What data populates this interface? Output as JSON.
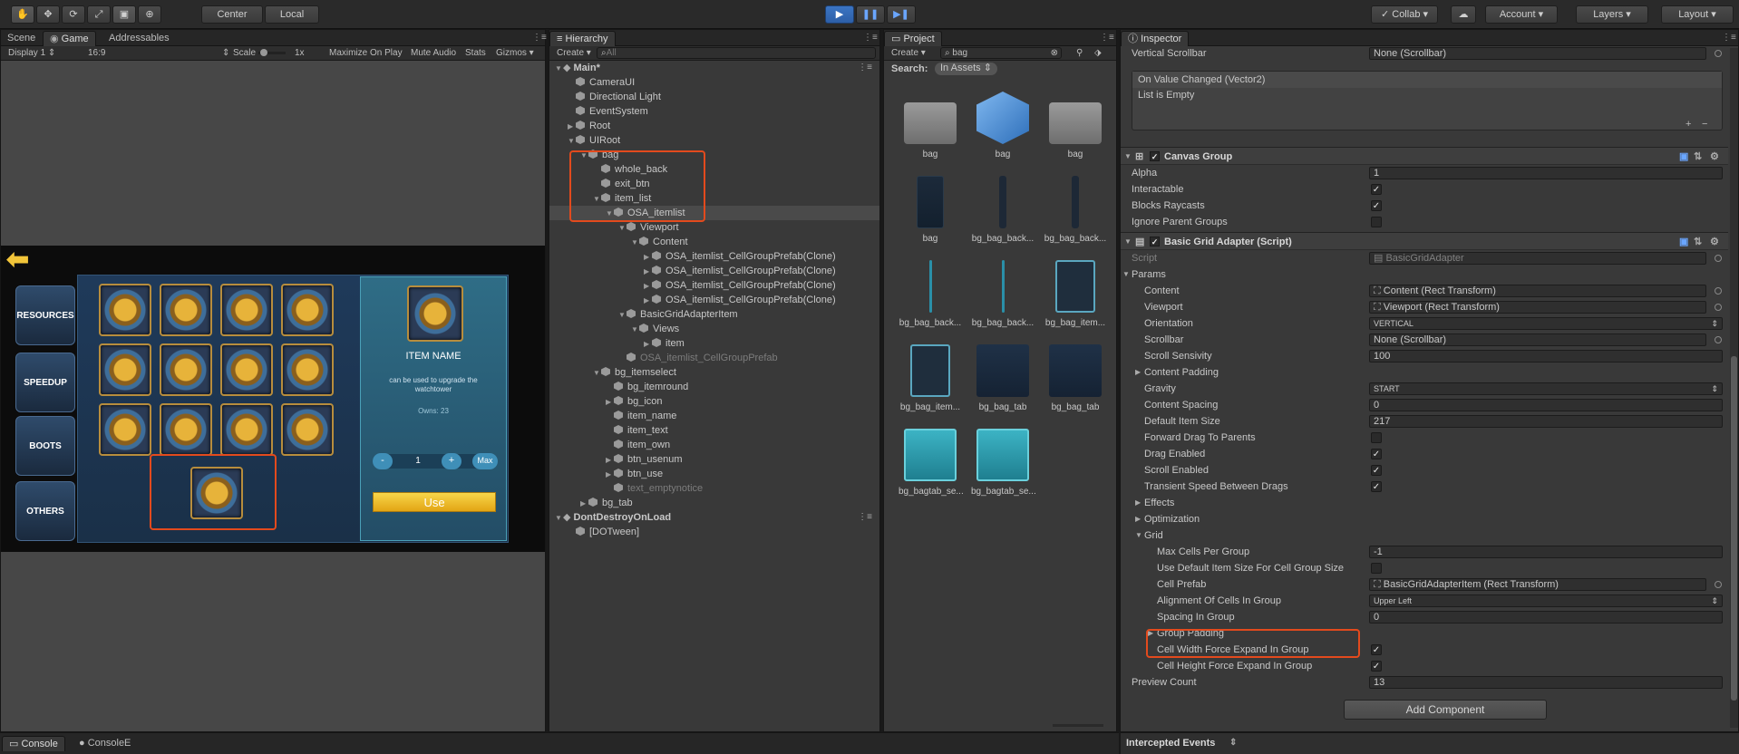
{
  "toolbar": {
    "pivot_center": "Center",
    "pivot_local": "Local",
    "collab": "Collab",
    "account": "Account",
    "layers": "Layers",
    "layout": "Layout"
  },
  "game_panel": {
    "tabs": [
      "Scene",
      "Game",
      "Addressables"
    ],
    "display": "Display 1",
    "aspect": "16:9",
    "scale_label": "Scale",
    "scale_value": "1x",
    "maximize": "Maximize On Play",
    "mute": "Mute Audio",
    "stats": "Stats",
    "gizmos": "Gizmos",
    "side_buttons": [
      "RESOURCES",
      "SPEEDUP",
      "BOOTS",
      "OTHERS"
    ],
    "detail": {
      "item_name": "ITEM NAME",
      "description": "can be used to upgrade the watchtower",
      "owns": "Owns: 23",
      "minus": "-",
      "quantity": "1",
      "plus": "+",
      "max": "Max",
      "use": "Use"
    }
  },
  "hierarchy": {
    "title": "Hierarchy",
    "create": "Create",
    "search_placeholder": "All",
    "rows": [
      {
        "label": "Main*",
        "indent": 0,
        "arrow": "▼",
        "scene": true
      },
      {
        "label": "CameraUI",
        "indent": 1,
        "arrow": ""
      },
      {
        "label": "Directional Light",
        "indent": 1,
        "arrow": ""
      },
      {
        "label": "EventSystem",
        "indent": 1,
        "arrow": ""
      },
      {
        "label": "Root",
        "indent": 1,
        "arrow": "▶"
      },
      {
        "label": "UIRoot",
        "indent": 1,
        "arrow": "▼"
      },
      {
        "label": "bag",
        "indent": 2,
        "arrow": "▼"
      },
      {
        "label": "whole_back",
        "indent": 3,
        "arrow": ""
      },
      {
        "label": "exit_btn",
        "indent": 3,
        "arrow": ""
      },
      {
        "label": "item_list",
        "indent": 3,
        "arrow": "▼"
      },
      {
        "label": "OSA_itemlist",
        "indent": 4,
        "arrow": "▼",
        "selected": true
      },
      {
        "label": "Viewport",
        "indent": 5,
        "arrow": "▼"
      },
      {
        "label": "Content",
        "indent": 6,
        "arrow": "▼"
      },
      {
        "label": "OSA_itemlist_CellGroupPrefab(Clone)",
        "indent": 7,
        "arrow": "▶"
      },
      {
        "label": "OSA_itemlist_CellGroupPrefab(Clone)",
        "indent": 7,
        "arrow": "▶"
      },
      {
        "label": "OSA_itemlist_CellGroupPrefab(Clone)",
        "indent": 7,
        "arrow": "▶"
      },
      {
        "label": "OSA_itemlist_CellGroupPrefab(Clone)",
        "indent": 7,
        "arrow": "▶"
      },
      {
        "label": "BasicGridAdapterItem",
        "indent": 5,
        "arrow": "▼"
      },
      {
        "label": "Views",
        "indent": 6,
        "arrow": "▼"
      },
      {
        "label": "item",
        "indent": 7,
        "arrow": "▶"
      },
      {
        "label": "OSA_itemlist_CellGroupPrefab",
        "indent": 5,
        "arrow": "",
        "dim": true
      },
      {
        "label": "bg_itemselect",
        "indent": 3,
        "arrow": "▼"
      },
      {
        "label": "bg_itemround",
        "indent": 4,
        "arrow": ""
      },
      {
        "label": "bg_icon",
        "indent": 4,
        "arrow": "▶"
      },
      {
        "label": "item_name",
        "indent": 4,
        "arrow": ""
      },
      {
        "label": "item_text",
        "indent": 4,
        "arrow": ""
      },
      {
        "label": "item_own",
        "indent": 4,
        "arrow": ""
      },
      {
        "label": "btn_usenum",
        "indent": 4,
        "arrow": "▶"
      },
      {
        "label": "btn_use",
        "indent": 4,
        "arrow": "▶"
      },
      {
        "label": "text_emptynotice",
        "indent": 4,
        "arrow": "",
        "dim": true
      },
      {
        "label": "bg_tab",
        "indent": 2,
        "arrow": "▶"
      },
      {
        "label": "DontDestroyOnLoad",
        "indent": 0,
        "arrow": "▼",
        "scene": true
      },
      {
        "label": "[DOTween]",
        "indent": 1,
        "arrow": ""
      }
    ]
  },
  "project": {
    "title": "Project",
    "create": "Create",
    "search_value": "bag",
    "search_label": "Search:",
    "search_scope": "In Assets",
    "assets": [
      {
        "label": "bag",
        "kind": "folder"
      },
      {
        "label": "bag",
        "kind": "cube"
      },
      {
        "label": "bag",
        "kind": "folder"
      },
      {
        "label": "bag",
        "kind": "sprite"
      },
      {
        "label": "bg_bag_back...",
        "kind": "thin"
      },
      {
        "label": "bg_bag_back...",
        "kind": "thin"
      },
      {
        "label": "bg_bag_back...",
        "kind": "line"
      },
      {
        "label": "bg_bag_back...",
        "kind": "line"
      },
      {
        "label": "bg_bag_item...",
        "kind": "frame"
      },
      {
        "label": "bg_bag_item...",
        "kind": "frame"
      },
      {
        "label": "bg_bag_tab",
        "kind": "dark"
      },
      {
        "label": "bg_bag_tab",
        "kind": "dark"
      },
      {
        "label": "bg_bagtab_se...",
        "kind": "teal"
      },
      {
        "label": "bg_bagtab_se...",
        "kind": "teal"
      }
    ]
  },
  "inspector": {
    "title": "Inspector",
    "vertical_scrollbar_label": "Vertical Scrollbar",
    "vertical_scrollbar_value": "None (Scrollbar)",
    "event_title": "On Value Changed (Vector2)",
    "event_empty": "List is Empty",
    "event_plus": "+",
    "event_minus": "−",
    "canvas_group": {
      "title": "Canvas Group",
      "rows": [
        {
          "label": "Alpha",
          "type": "text",
          "value": "1"
        },
        {
          "label": "Interactable",
          "type": "check",
          "value": "✓"
        },
        {
          "label": "Blocks Raycasts",
          "type": "check",
          "value": "✓"
        },
        {
          "label": "Ignore Parent Groups",
          "type": "check",
          "value": ""
        }
      ]
    },
    "adapter": {
      "title": "Basic Grid Adapter (Script)",
      "script_label": "Script",
      "script_value": "BasicGridAdapter",
      "params_label": "Params",
      "rows": [
        {
          "label": "Content",
          "type": "obj",
          "value": "Content (Rect Transform)",
          "indent": 1
        },
        {
          "label": "Viewport",
          "type": "obj",
          "value": "Viewport (Rect Transform)",
          "indent": 1
        },
        {
          "label": "Orientation",
          "type": "enum",
          "value": "VERTICAL",
          "indent": 1
        },
        {
          "label": "Scrollbar",
          "type": "obj",
          "value": "None (Scrollbar)",
          "indent": 1
        },
        {
          "label": "Scroll Sensivity",
          "type": "text",
          "value": "100",
          "indent": 1
        },
        {
          "label": "Content Padding",
          "type": "fold",
          "value": "",
          "indent": 1
        },
        {
          "label": "Gravity",
          "type": "enum",
          "value": "START",
          "indent": 1
        },
        {
          "label": "Content Spacing",
          "type": "text",
          "value": "0",
          "indent": 1
        },
        {
          "label": "Default Item Size",
          "type": "text",
          "value": "217",
          "indent": 1
        },
        {
          "label": "Forward Drag To Parents",
          "type": "check",
          "value": "",
          "indent": 1
        },
        {
          "label": "Drag Enabled",
          "type": "check",
          "value": "✓",
          "indent": 1
        },
        {
          "label": "Scroll Enabled",
          "type": "check",
          "value": "✓",
          "indent": 1
        },
        {
          "label": "Transient Speed Between Drags",
          "type": "check",
          "value": "✓",
          "indent": 1
        },
        {
          "label": "Effects",
          "type": "fold",
          "value": "",
          "indent": 1
        },
        {
          "label": "Optimization",
          "type": "fold",
          "value": "",
          "indent": 1
        },
        {
          "label": "Grid",
          "type": "foldopen",
          "value": "",
          "indent": 1
        },
        {
          "label": "Max Cells Per Group",
          "type": "text",
          "value": "-1",
          "indent": 2
        },
        {
          "label": "Use Default Item Size For Cell Group Size",
          "type": "check",
          "value": "",
          "indent": 2
        },
        {
          "label": "Cell Prefab",
          "type": "obj",
          "value": "BasicGridAdapterItem (Rect Transform)",
          "indent": 2
        },
        {
          "label": "Alignment Of Cells In Group",
          "type": "enum",
          "value": "Upper Left",
          "indent": 2
        },
        {
          "label": "Spacing In Group",
          "type": "text",
          "value": "0",
          "indent": 2
        },
        {
          "label": "Group Padding",
          "type": "fold",
          "value": "",
          "indent": 2
        },
        {
          "label": "Cell Width Force Expand In Group",
          "type": "check",
          "value": "✓",
          "indent": 2
        },
        {
          "label": "Cell Height Force Expand In Group",
          "type": "check",
          "value": "✓",
          "indent": 2
        },
        {
          "label": "Preview Count",
          "type": "text",
          "value": "13",
          "indent": 0
        }
      ]
    },
    "add_component": "Add Component",
    "intercepted": "Intercepted Events"
  },
  "console": {
    "tabs": [
      "Console",
      "ConsoleE"
    ]
  }
}
